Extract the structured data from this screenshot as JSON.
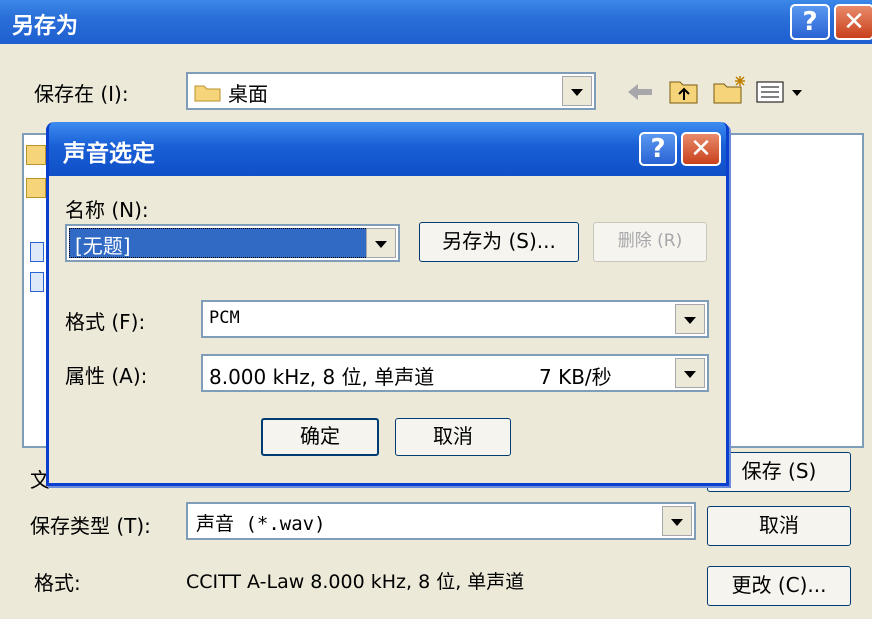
{
  "outer": {
    "title": "另存为",
    "help_label": "?",
    "close_label": "✕",
    "save_in_label": "保存在 (I):",
    "save_in_value": "桌面",
    "filename_label_partial": "文",
    "file_type_label": "保存类型 (T):",
    "file_type_value": "声音 (*.wav)",
    "format_label": "格式:",
    "format_value": "CCITT A-Law 8.000 kHz, 8 位, 单声道",
    "save_button": "保存 (S)",
    "cancel_button": "取消",
    "change_button": "更改 (C)..."
  },
  "inner": {
    "title": "声音选定",
    "help_label": "?",
    "close_label": "✕",
    "name_label": "名称 (N):",
    "name_value": "[无题]",
    "save_as_button": "另存为 (S)...",
    "delete_button": "删除 (R)",
    "format_label": "格式 (F):",
    "format_value": "PCM",
    "attributes_label": "属性 (A):",
    "attributes_value": "8.000 kHz, 8 位, 单声道",
    "attributes_rate": "7 KB/秒",
    "ok_button": "确定",
    "cancel_button": "取消"
  },
  "colors": {
    "titlebar": "#1f5fd0",
    "dialog_bg": "#ece9d8",
    "selection": "#316ac5",
    "close_btn": "#c9411c"
  },
  "icons": [
    "folder-icon",
    "back-arrow-icon",
    "up-folder-icon",
    "new-folder-icon",
    "view-menu-icon"
  ]
}
